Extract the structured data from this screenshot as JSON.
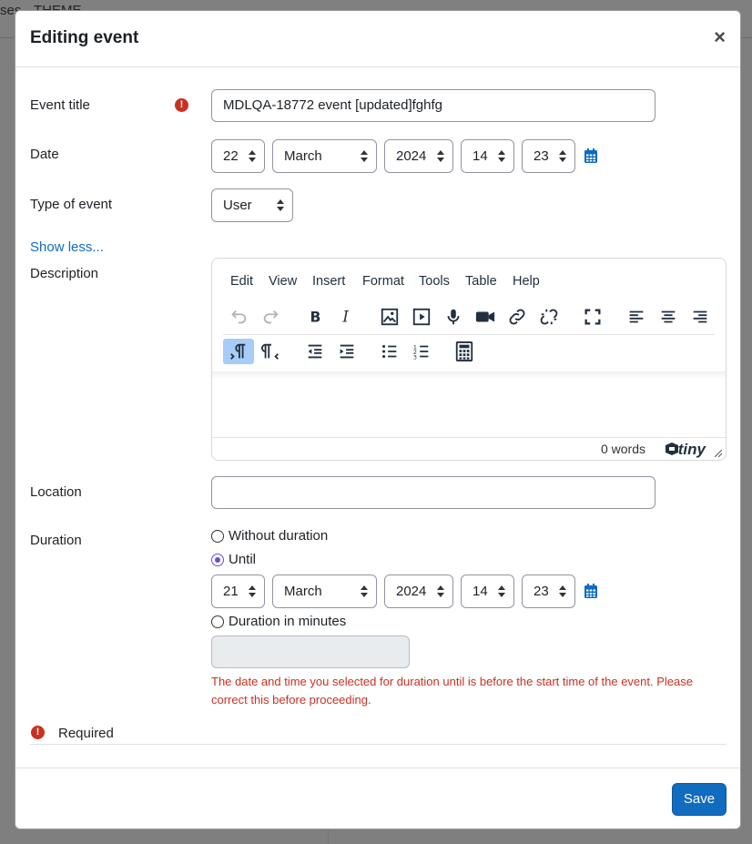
{
  "background": {
    "left_text": "ses",
    "right_text": "THEME"
  },
  "modal": {
    "title": "Editing event",
    "close_label": "×",
    "accent_color": "#0f6cbf",
    "error_color": "#ca3120"
  },
  "form": {
    "event_title": {
      "label": "Event title",
      "value": "MDLQA-18772 event [updated]fghfg",
      "required_icon": "!"
    },
    "date": {
      "label": "Date",
      "day": "22",
      "month": "March",
      "year": "2024",
      "hour": "14",
      "minute": "23",
      "icon": "calendar-icon"
    },
    "type_of_event": {
      "label": "Type of event",
      "value": "User"
    },
    "show_less": "Show less...",
    "description": {
      "label": "Description",
      "menu": [
        "Edit",
        "View",
        "Insert",
        "Format",
        "Tools",
        "Table",
        "Help"
      ],
      "word_count": "0 words",
      "brand": "tiny"
    },
    "location": {
      "label": "Location",
      "value": ""
    },
    "duration": {
      "label": "Duration",
      "option_without": "Without duration",
      "option_until": "Until",
      "option_minutes": "Duration in minutes",
      "selected": "until",
      "until_day": "21",
      "until_month": "March",
      "until_year": "2024",
      "until_hour": "14",
      "until_minute": "23",
      "minutes_value": "",
      "error": "The date and time you selected for duration until is before the start time of the event. Please correct this before proceeding."
    },
    "required_note": "Required",
    "required_icon": "!"
  },
  "footer": {
    "save_label": "Save"
  }
}
